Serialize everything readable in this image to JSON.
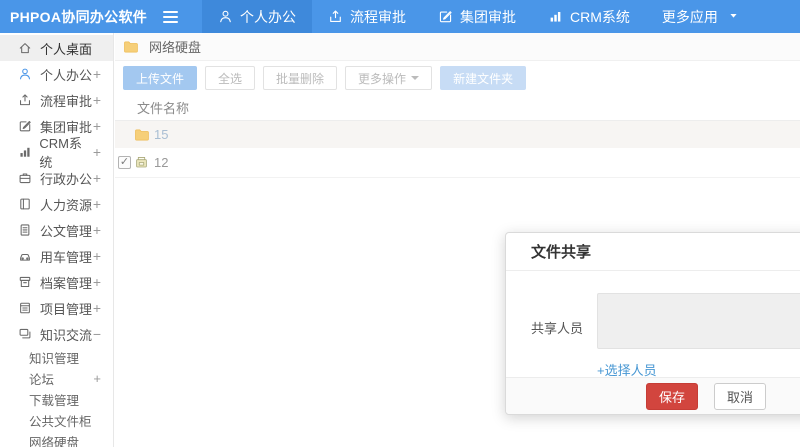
{
  "topbar": {
    "logo": "PHPOA协同办公软件",
    "nav": [
      {
        "label": "个人办公",
        "icon": "person-icon",
        "active": true
      },
      {
        "label": "流程审批",
        "icon": "approval-icon",
        "active": false
      },
      {
        "label": "集团审批",
        "icon": "edit-icon",
        "active": false
      },
      {
        "label": "CRM系统",
        "icon": "chart-icon",
        "active": false
      },
      {
        "label": "更多应用",
        "icon": "caret-down-icon",
        "active": false,
        "caret": true
      }
    ]
  },
  "sidebar": {
    "items": [
      {
        "label": "个人桌面",
        "icon": "home-icon",
        "active": true,
        "expand": ""
      },
      {
        "label": "个人办公",
        "icon": "person-icon",
        "icon_color": "#4a96e8",
        "expand": "+"
      },
      {
        "label": "流程审批",
        "icon": "approval-icon",
        "expand": "+"
      },
      {
        "label": "集团审批",
        "icon": "edit-icon",
        "expand": "+"
      },
      {
        "label": "CRM系统",
        "icon": "chart-icon",
        "expand": "+"
      },
      {
        "label": "行政办公",
        "icon": "briefcase-icon",
        "expand": "+"
      },
      {
        "label": "人力资源",
        "icon": "book-icon",
        "expand": "+"
      },
      {
        "label": "公文管理",
        "icon": "document-icon",
        "expand": "+"
      },
      {
        "label": "用车管理",
        "icon": "car-icon",
        "expand": "+"
      },
      {
        "label": "档案管理",
        "icon": "archive-icon",
        "expand": "+"
      },
      {
        "label": "项目管理",
        "icon": "project-icon",
        "expand": "+"
      },
      {
        "label": "知识交流",
        "icon": "chat-icon",
        "expand": "−",
        "expanded": true
      }
    ],
    "subitems": [
      {
        "label": "知识管理",
        "expand": ""
      },
      {
        "label": "论坛",
        "expand": "+"
      },
      {
        "label": "下载管理",
        "expand": ""
      },
      {
        "label": "公共文件柜",
        "expand": ""
      },
      {
        "label": "网络硬盘",
        "expand": ""
      }
    ]
  },
  "content": {
    "breadcrumb": {
      "icon": "folder-icon",
      "label": "网络硬盘"
    },
    "toolbar": [
      {
        "label": "上传文件",
        "style": "primary"
      },
      {
        "label": "全选",
        "style": "default"
      },
      {
        "label": "批量删除",
        "style": "default"
      },
      {
        "label": "更多操作",
        "style": "default",
        "caret": true
      },
      {
        "label": "新建文件夹",
        "style": "primary-light"
      }
    ],
    "table": {
      "header": "文件名称",
      "rows": [
        {
          "name": "15",
          "icon": "folder-icon",
          "checked": false,
          "highlighted": true
        },
        {
          "name": "12",
          "icon": "cabinet-icon",
          "checked": true,
          "highlighted": false
        }
      ]
    }
  },
  "modal": {
    "title": "文件共享",
    "field_label": "共享人员",
    "textarea_value": "",
    "choose_link": "+选择人员",
    "save_label": "保存",
    "cancel_label": "取消"
  },
  "colors": {
    "topbar_bg": "#4a96e8",
    "topbar_active_bg": "#3e89db",
    "accent_blue": "#4a96e8",
    "primary_btn_bg": "#a3c8f0",
    "primary_light_btn_bg": "#c7dcf5",
    "save_btn_bg": "#d2453e",
    "folder_yellow": "#f6cf79",
    "highlight_row_bg": "#f7f5f3",
    "link_blue": "#4797d3"
  }
}
